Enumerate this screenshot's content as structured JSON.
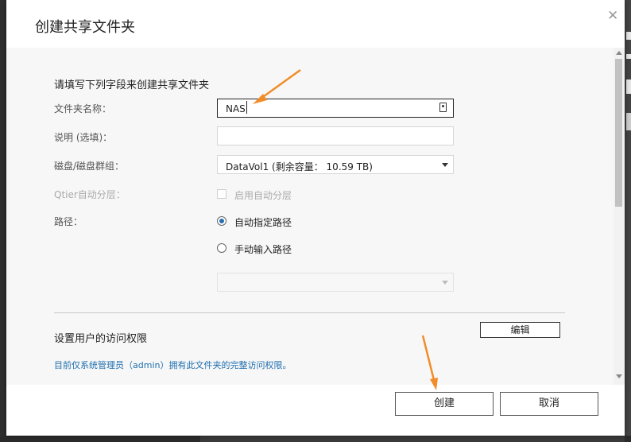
{
  "dialog": {
    "title": "创建共享文件夹",
    "close_glyph": "✕"
  },
  "form": {
    "section_title": "请填写下列字段来创建共享文件夹",
    "folder_name": {
      "label": "文件夹名称：",
      "value": "NAS"
    },
    "description": {
      "label": "说明 (选填)：",
      "value": ""
    },
    "disk_volume": {
      "label": "磁盘/磁盘群组：",
      "value": "DataVol1 (剩余容量： 10.59 TB)"
    },
    "qtier": {
      "label": "Qtier自动分层：",
      "checkbox_label": "启用自动分层",
      "checked": false,
      "disabled": true
    },
    "path": {
      "label": "路径：",
      "options": [
        {
          "label": "自动指定路径",
          "selected": true
        },
        {
          "label": "手动输入路径",
          "selected": false
        }
      ],
      "manual_path_value": ""
    }
  },
  "permissions": {
    "title": "设置用户的访问权限",
    "edit_label": "编辑",
    "note": "目前仅系统管理员（admin）拥有此文件夹的完整访问权限。"
  },
  "footer": {
    "create_label": "创建",
    "cancel_label": "取消"
  },
  "colors": {
    "annotation_arrow": "#f28c28",
    "link_text": "#1f6fb0",
    "radio_accent": "#2a6fb0"
  }
}
